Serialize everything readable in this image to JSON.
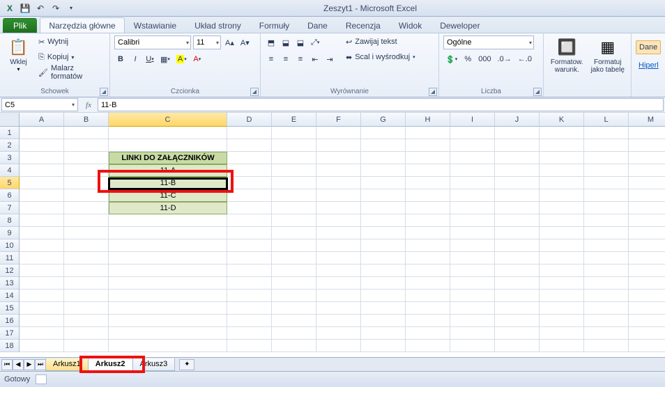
{
  "app": {
    "title": "Zeszyt1 - Microsoft Excel"
  },
  "qat": {
    "save": "💾",
    "undo": "↶",
    "redo": "↷"
  },
  "tabs": {
    "file": "Plik",
    "items": [
      "Narzędzia główne",
      "Wstawianie",
      "Układ strony",
      "Formuły",
      "Dane",
      "Recenzja",
      "Widok",
      "Deweloper"
    ],
    "active": 0
  },
  "ribbon": {
    "clipboard": {
      "label": "Schowek",
      "paste": "Wklej",
      "cut": "Wytnij",
      "copy": "Kopiuj",
      "painter": "Malarz formatów"
    },
    "font": {
      "label": "Czcionka",
      "family": "Calibri",
      "size": "11"
    },
    "align": {
      "label": "Wyrównanie",
      "wrap": "Zawijaj tekst",
      "merge": "Scal i wyśrodkuj"
    },
    "number": {
      "label": "Liczba",
      "format": "Ogólne"
    },
    "styles": {
      "cond": "Formatow.\nwarunk.",
      "table": "Formatuj\njako tabelę"
    },
    "extra": {
      "dane": "Dane",
      "link": "Hiperl"
    }
  },
  "namebox": "C5",
  "formula": "11-B",
  "columns": [
    "A",
    "B",
    "C",
    "D",
    "E",
    "F",
    "G",
    "H",
    "I",
    "J",
    "K",
    "L",
    "M"
  ],
  "rows": [
    "1",
    "2",
    "3",
    "4",
    "5",
    "6",
    "7",
    "8",
    "9",
    "10",
    "11",
    "12",
    "13",
    "14",
    "15",
    "16",
    "17",
    "18"
  ],
  "cells": {
    "header": "LINKI DO ZAŁĄCZNIKÓW",
    "links": [
      "11-A",
      "11-B",
      "11-C",
      "11-D"
    ]
  },
  "selected": {
    "row": 5,
    "col": "C"
  },
  "sheets": {
    "items": [
      "Arkusz1",
      "Arkusz2",
      "Arkusz3"
    ],
    "active": 1
  },
  "status": {
    "ready": "Gotowy"
  }
}
